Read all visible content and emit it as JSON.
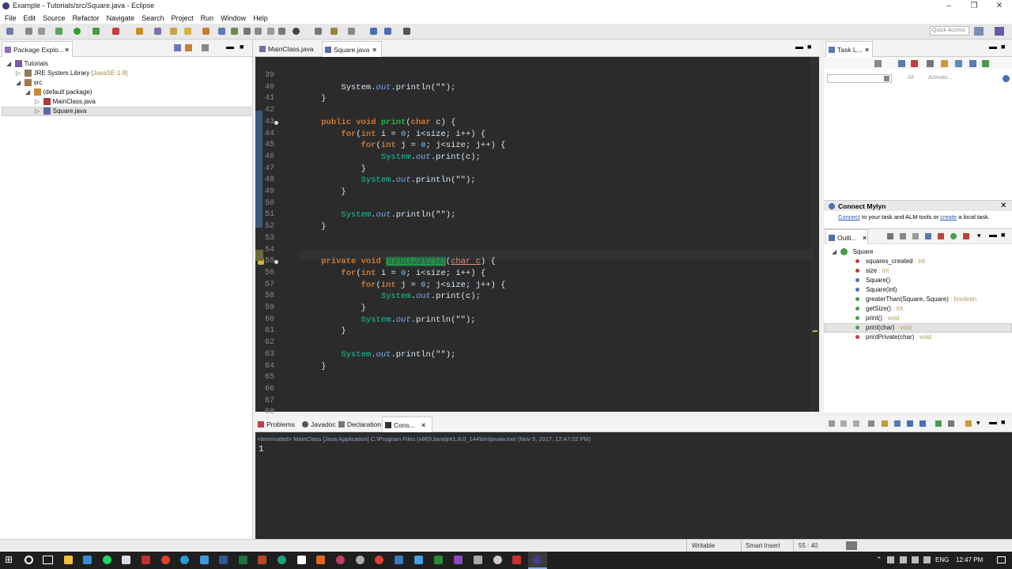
{
  "window": {
    "title": "Example - Tutorials/src/Square.java - Eclipse"
  },
  "menu": [
    "File",
    "Edit",
    "Source",
    "Refactor",
    "Navigate",
    "Search",
    "Project",
    "Run",
    "Window",
    "Help"
  ],
  "quick_access": {
    "placeholder": "Quick Access"
  },
  "package_explorer": {
    "tab": "Package Explo...",
    "items": [
      {
        "label": "Tutorials"
      },
      {
        "label": "JRE System Library",
        "suffix": "[JavaSE-1.8]"
      },
      {
        "label": "src"
      },
      {
        "label": "(default package)"
      },
      {
        "label": "MainClass.java"
      },
      {
        "label": "Square.java"
      }
    ]
  },
  "editor": {
    "tabs": [
      {
        "label": "MainClass.java"
      },
      {
        "label": "Square.java"
      }
    ],
    "lines": [
      39,
      40,
      41,
      42,
      43,
      44,
      45,
      46,
      47,
      48,
      49,
      50,
      51,
      52,
      53,
      54,
      55,
      56,
      57,
      58,
      59,
      60,
      61,
      62,
      63,
      64,
      65,
      66,
      67,
      68
    ]
  },
  "task_list": {
    "tab": "Task L...",
    "filter_all": "All",
    "filter_activate": "Activate..."
  },
  "mylyn": {
    "title": "Connect Mylyn",
    "connect": "Connect",
    "text1": " to your task and ALM tools or ",
    "create": "create",
    "text2": " a local task."
  },
  "outline": {
    "tab": "Outli...",
    "class": "Square",
    "items": [
      {
        "name": "squares_created",
        "type": " : int"
      },
      {
        "name": "size",
        "type": " : int"
      },
      {
        "name": "Square()",
        "type": ""
      },
      {
        "name": "Square(int)",
        "type": ""
      },
      {
        "name": "greaterThan(Square, Square)",
        "type": " : boolean"
      },
      {
        "name": "getSize()",
        "type": " : int"
      },
      {
        "name": "print()",
        "type": " : void"
      },
      {
        "name": "print(char)",
        "type": " : void"
      },
      {
        "name": "printPrivate(char)",
        "type": " : void"
      }
    ]
  },
  "console": {
    "tabs": [
      {
        "label": "Problems"
      },
      {
        "label": "Javadoc"
      },
      {
        "label": "Declaration"
      },
      {
        "label": "Cons..."
      }
    ],
    "header": "<terminated> MainClass [Java Application] C:\\Program Files (x86)\\Java\\jre1.8.0_144\\bin\\javaw.exe (Nov 5, 2017, 12:47:02 PM)",
    "output": "1"
  },
  "status": {
    "writable": "Writable",
    "insert": "Smart Insert",
    "position": "55 : 40"
  },
  "taskbar": {
    "lang": "ENG",
    "time": "12:47 PM"
  },
  "colors": {
    "keyword": "#cc7832",
    "string": "#17c6a3",
    "method": "#1eb540",
    "field": "#79abff",
    "background": "#2b2b2b"
  }
}
